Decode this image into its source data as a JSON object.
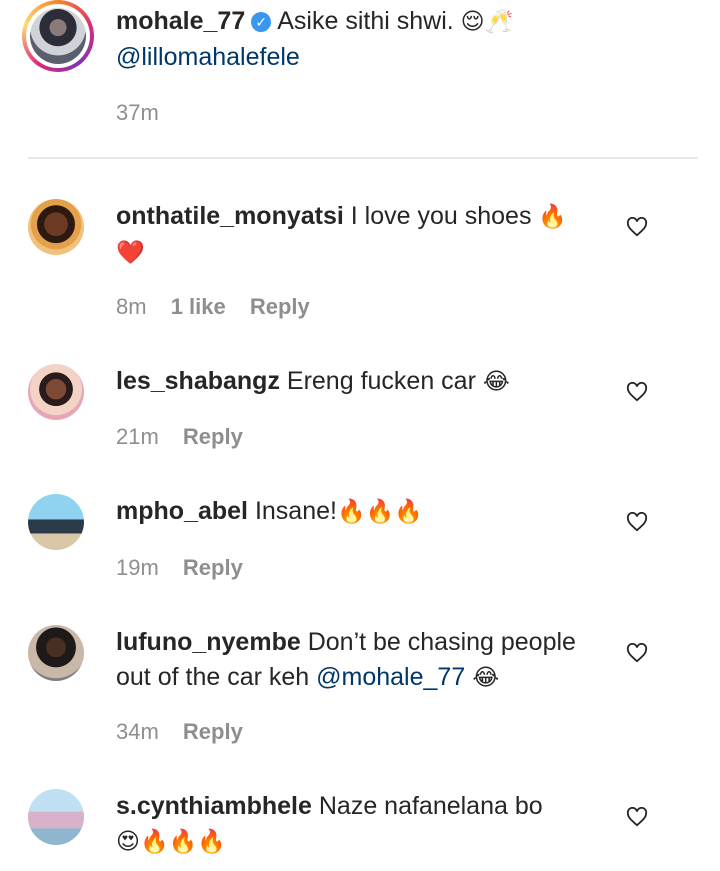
{
  "caption": {
    "username": "mohale_77",
    "text": "Asike sithi shwi.",
    "emoji": "😌🥂",
    "mention": "@lillomahalefele",
    "time": "37m"
  },
  "comments": [
    {
      "username": "onthatile_monyatsi",
      "text": "I love you shoes",
      "emoji1": "🔥",
      "emoji2": "❤️",
      "time": "8m",
      "likes": "1 like",
      "reply": "Reply"
    },
    {
      "username": "les_shabangz",
      "text": "Ereng fucken car",
      "emoji": "😂",
      "time": "21m",
      "reply": "Reply"
    },
    {
      "username": "mpho_abel",
      "text": "Insane!",
      "emoji": "🔥🔥🔥",
      "time": "19m",
      "reply": "Reply"
    },
    {
      "username": "lufuno_nyembe",
      "text": "Don’t be chasing people out of the car keh",
      "mention": "@mohale_77",
      "emoji": "😂",
      "time": "34m",
      "reply": "Reply"
    },
    {
      "username": "s.cynthiambhele",
      "text": "Naze nafanelana bo",
      "emoji": "😍🔥🔥🔥"
    }
  ]
}
